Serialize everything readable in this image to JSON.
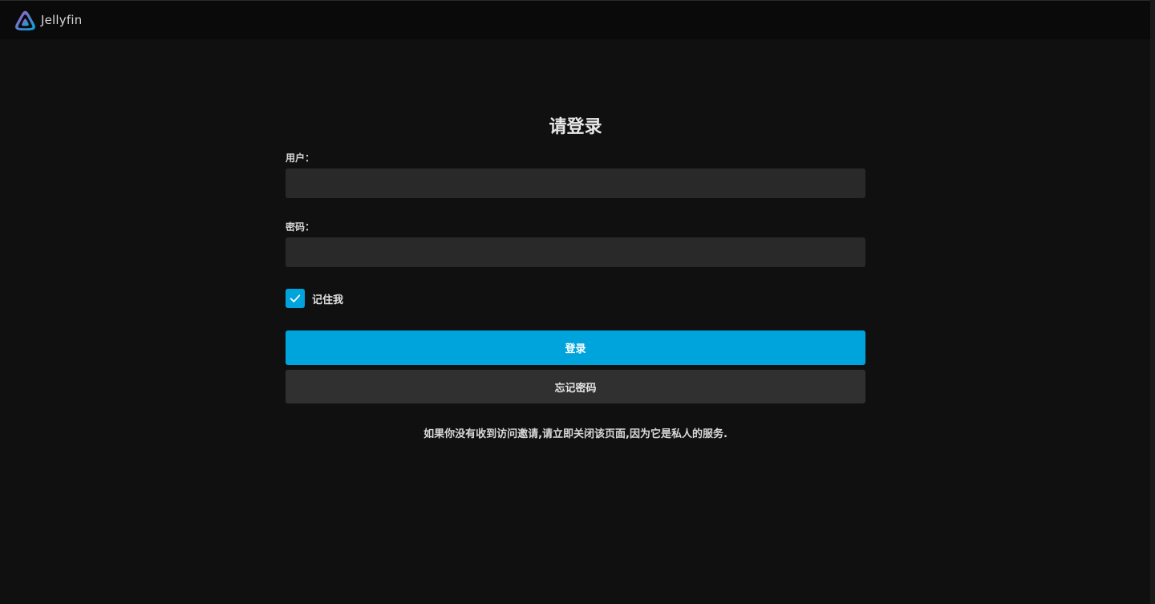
{
  "header": {
    "brand": "Jellyfin",
    "logo_icon": "jellyfin-logo-icon"
  },
  "login": {
    "title": "请登录",
    "username_label": "用户：",
    "username_value": "",
    "password_label": "密码：",
    "password_value": "",
    "remember_label": "记住我",
    "remember_checked": true,
    "submit_label": "登录",
    "forgot_label": "忘记密码",
    "disclaimer": "如果你没有收到访问邀请,请立即关闭该页面,因为它是私人的服务."
  },
  "colors": {
    "accent": "#00a4dc",
    "background": "#101010",
    "header": "#0a0a0a",
    "input": "#292929",
    "secondary_button": "#303030"
  }
}
